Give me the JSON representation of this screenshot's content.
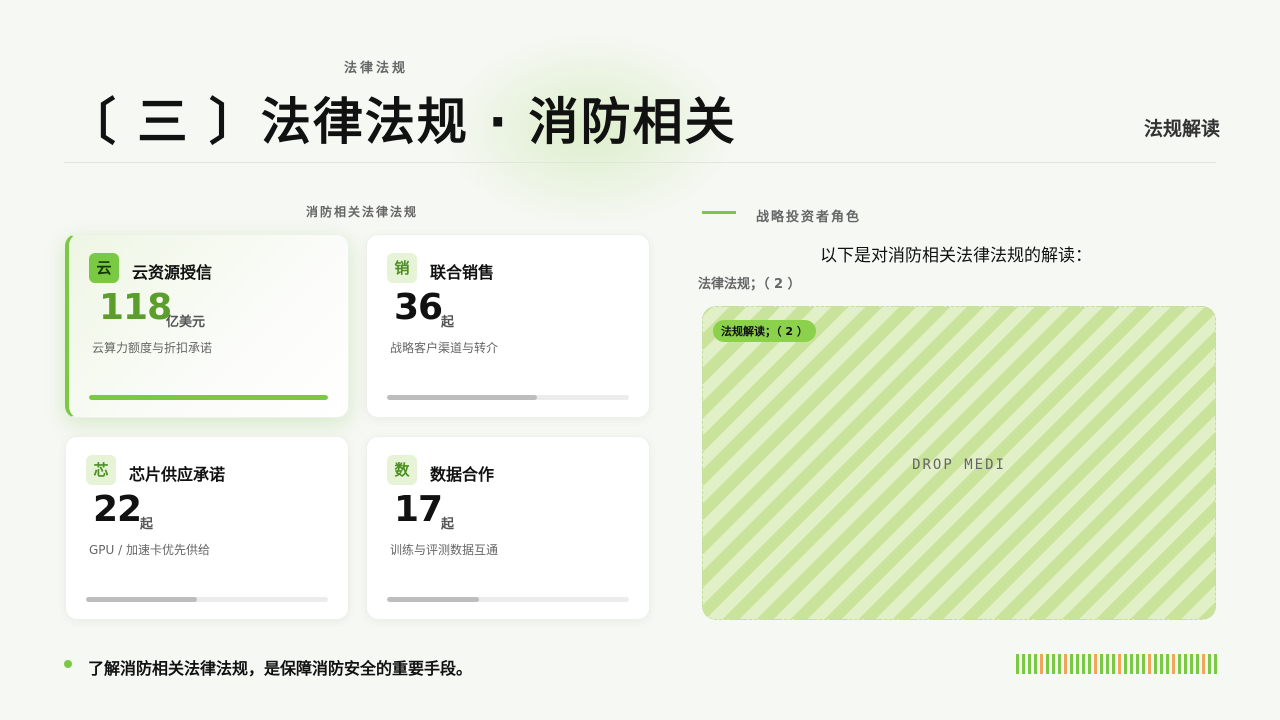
{
  "header": {
    "kicker": "法律法规",
    "title": "〔 三 〕法律法规 · 消防相关",
    "right_label": "法规解读"
  },
  "left": {
    "section_label": "消防相关法律法规",
    "cards": [
      {
        "badge": "云",
        "title": "云资源授信",
        "value": "118",
        "unit": "亿美元",
        "desc": "云算力额度与折扣承诺",
        "progress": 1.0
      },
      {
        "badge": "销",
        "title": "联合销售",
        "value": "36",
        "unit": "起",
        "desc": "战略客户渠道与转介",
        "progress": 0.62
      },
      {
        "badge": "芯",
        "title": "芯片供应承诺",
        "value": "22",
        "unit": "起",
        "desc": "GPU / 加速卡优先供给",
        "progress": 0.46
      },
      {
        "badge": "数",
        "title": "数据合作",
        "value": "17",
        "unit": "起",
        "desc": "训练与评测数据互通",
        "progress": 0.38
      }
    ]
  },
  "right": {
    "heading": "战略投资者角色",
    "intro": "以下是对消防相关法律法规的解读：",
    "meta": "法律法规；（ 2 ）",
    "pill": "法规解读；（ 2 ）",
    "drop_text": "DROP MEDI"
  },
  "footer": {
    "text": "了解消防相关法律法规，是保障消防安全的重要手段。"
  },
  "colors": {
    "accent": "#7ac943",
    "accent_dark": "#5b9e2c",
    "track": "#ececec",
    "barcode": [
      "#7ac943",
      "#f0a55a"
    ]
  }
}
